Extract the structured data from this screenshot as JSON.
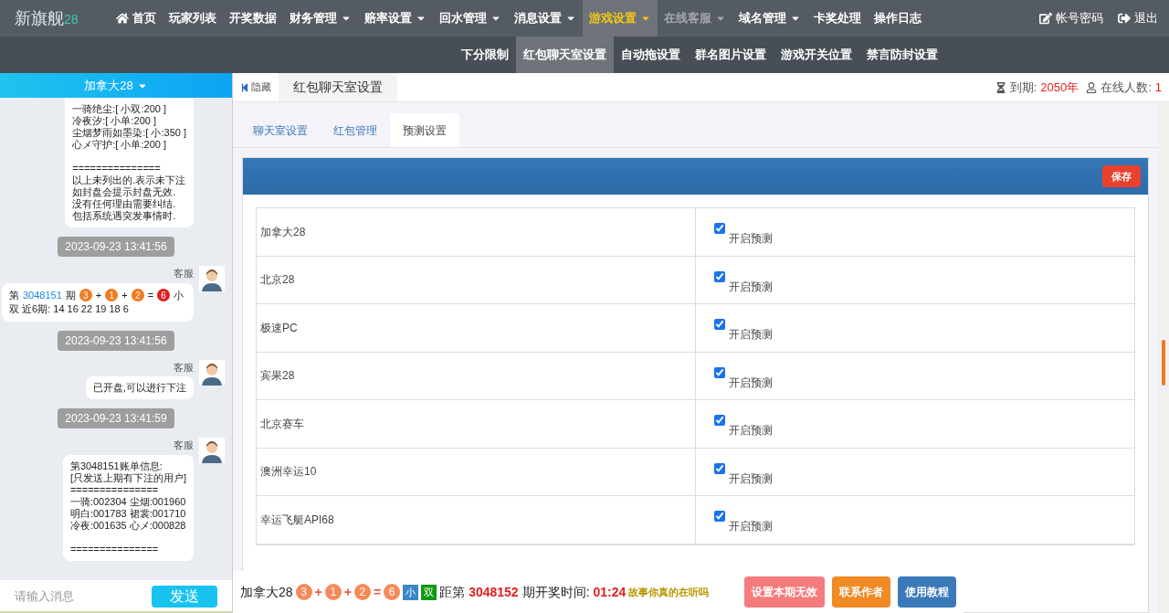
{
  "brand": {
    "name": "新旗舰",
    "suffix": "28"
  },
  "nav": [
    {
      "label": "首页",
      "caret": false,
      "selected": false,
      "disabled": false
    },
    {
      "label": "玩家列表",
      "caret": false,
      "selected": false,
      "disabled": false
    },
    {
      "label": "开奖数据",
      "caret": false,
      "selected": false,
      "disabled": false
    },
    {
      "label": "财务管理",
      "caret": true,
      "selected": false,
      "disabled": false
    },
    {
      "label": "赔率设置",
      "caret": true,
      "selected": false,
      "disabled": false
    },
    {
      "label": "回水管理",
      "caret": true,
      "selected": false,
      "disabled": false
    },
    {
      "label": "消息设置",
      "caret": true,
      "selected": false,
      "disabled": false
    },
    {
      "label": "游戏设置",
      "caret": true,
      "selected": true,
      "disabled": false
    },
    {
      "label": "在线客服",
      "caret": true,
      "selected": false,
      "disabled": true
    },
    {
      "label": "域名管理",
      "caret": true,
      "selected": false,
      "disabled": false
    },
    {
      "label": "卡奖处理",
      "caret": false,
      "selected": false,
      "disabled": false
    },
    {
      "label": "操作日志",
      "caret": false,
      "selected": false,
      "disabled": false
    }
  ],
  "nav_right": [
    "帐号密码",
    "退出"
  ],
  "subnav": [
    {
      "label": "下分限制",
      "selected": false
    },
    {
      "label": "红包聊天室设置",
      "selected": true
    },
    {
      "label": "自动拖设置",
      "selected": false
    },
    {
      "label": "群名图片设置",
      "selected": false
    },
    {
      "label": "游戏开关位置",
      "selected": false
    },
    {
      "label": "禁言防封设置",
      "selected": false
    }
  ],
  "chat": {
    "room": "加拿大28",
    "messages": [
      {
        "kind": "text",
        "blocks": [
          [
            "一骑绝尘:[ 小双:200 ]",
            "冷夜汐:[ 小单:200 ]",
            "尘烟梦雨如墨染:[ 小:350 ]",
            "心メ守护:[ 小单:200 ]"
          ],
          [
            "===============",
            "以上未列出的.表示未下注",
            "如封盘会提示封盘无效.",
            "没有任何理由需要纠结.",
            "包括系统遇突发事情时."
          ]
        ]
      },
      {
        "kind": "time",
        "text": "2023-09-23 13:41:56"
      },
      {
        "kind": "parts",
        "sender": "客服",
        "parts": [
          {
            "kind": "text",
            "text": "第"
          },
          {
            "kind": "link",
            "text": "3048151"
          },
          {
            "kind": "text",
            "text": "期"
          },
          {
            "kind": "ball",
            "text": "3",
            "color": "#f47a20"
          },
          {
            "kind": "text",
            "text": "+"
          },
          {
            "kind": "ball",
            "text": "1",
            "color": "#f47a20"
          },
          {
            "kind": "text",
            "text": "+"
          },
          {
            "kind": "ball",
            "text": "2",
            "color": "#f47a20"
          },
          {
            "kind": "text",
            "text": "="
          },
          {
            "kind": "ball",
            "text": "6",
            "color": "#e02020"
          },
          {
            "kind": "text",
            "text": "小"
          },
          {
            "kind": "text",
            "text": "双 近6期: 14 16 22 19 18 6"
          }
        ]
      },
      {
        "kind": "time",
        "text": "2023-09-23 13:41:56"
      },
      {
        "kind": "text",
        "sender": "客服",
        "blocks": [
          [
            "已开盘,可以进行下注"
          ]
        ]
      },
      {
        "kind": "time",
        "text": "2023-09-23 13:41:59"
      },
      {
        "kind": "text",
        "sender": "客服",
        "blocks": [
          [
            "第3048151账单信息:",
            "[只发送上期有下注的用户]",
            "===============",
            "一骑:002304 尘烟:001960",
            "明白:001783 裙裳:001710",
            "冷夜:001635 心メ:000828"
          ],
          [
            "==============="
          ]
        ]
      }
    ],
    "input_placeholder": "请输入消息",
    "send": "发送"
  },
  "toolbar": {
    "hide": "隐藏",
    "page_tab": "红包聊天室设置",
    "expire_label": "到期:",
    "expire_value": "2050年",
    "online_label": "在线人数:",
    "online_value": "1"
  },
  "tabs": [
    {
      "label": "聊天室设置",
      "selected": false
    },
    {
      "label": "红包管理",
      "selected": false
    },
    {
      "label": "预测设置",
      "selected": true
    }
  ],
  "save": "保存",
  "games": [
    {
      "name": "加拿大28",
      "checked": true,
      "label": "开启预测"
    },
    {
      "name": "北京28",
      "checked": true,
      "label": "开启预测"
    },
    {
      "name": "极速PC",
      "checked": true,
      "label": "开启预测"
    },
    {
      "name": "宾果28",
      "checked": true,
      "label": "开启预测"
    },
    {
      "name": "北京赛车",
      "checked": true,
      "label": "开启预测"
    },
    {
      "name": "澳洲幸运10",
      "checked": true,
      "label": "开启预测"
    },
    {
      "name": "幸运飞艇API68",
      "checked": true,
      "label": "开启预测"
    }
  ],
  "bottom": {
    "game": "加拿大28",
    "balls": [
      {
        "kind": "ball",
        "text": "3",
        "color": "#f58a5a"
      },
      {
        "kind": "op",
        "text": "+"
      },
      {
        "kind": "ball",
        "text": "1",
        "color": "#f58a5a"
      },
      {
        "kind": "op",
        "text": "+"
      },
      {
        "kind": "ball",
        "text": "2",
        "color": "#f58a5a"
      },
      {
        "kind": "op",
        "text": "="
      },
      {
        "kind": "ball",
        "text": "6",
        "color": "#f58a5a"
      },
      {
        "kind": "tag",
        "text": "小",
        "color": "#3a87c8"
      },
      {
        "kind": "tag",
        "text": "双",
        "color": "#119a11"
      }
    ],
    "before": "距第",
    "period": "3048152",
    "after": "期开奖时间:",
    "timer": "01:24",
    "marquee": "故事你真的在听吗",
    "buttons": [
      {
        "label": "设置本期无效",
        "color": "#f47c7c"
      },
      {
        "label": "联系作者",
        "color": "#f08a24"
      },
      {
        "label": "使用教程",
        "color": "#3b7ab8"
      }
    ]
  }
}
